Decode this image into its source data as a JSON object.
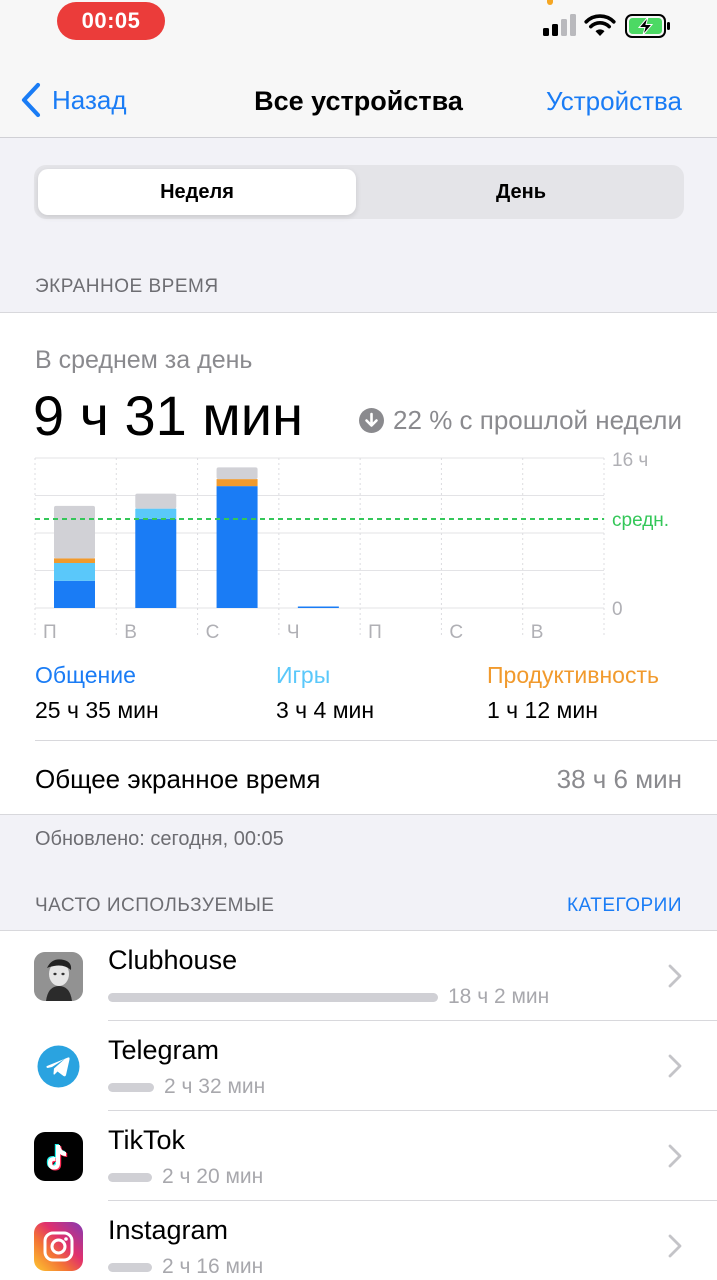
{
  "status": {
    "time": "00:05"
  },
  "nav": {
    "back_label": "Назад",
    "title": "Все устройства",
    "right_label": "Устройства"
  },
  "segments": {
    "week": "Неделя",
    "day": "День",
    "selected": "week"
  },
  "screen_time_header": "ЭКРАННОЕ ВРЕМЯ",
  "summary": {
    "avg_label": "В среднем за день",
    "avg_value": "9 ч 31 мин",
    "change": "22 % с прошлой недели",
    "change_direction": "down"
  },
  "chart_data": {
    "type": "bar",
    "categories": [
      "П",
      "В",
      "С",
      "Ч",
      "П",
      "С",
      "В"
    ],
    "unit": "hours",
    "ylim": [
      0,
      16
    ],
    "tick_labels": {
      "top": "16 ч",
      "bottom": "0"
    },
    "average_label": "средн.",
    "average_value": 9.5,
    "series": [
      {
        "name": "Общение",
        "color": "#1a7cf5",
        "values": [
          2.9,
          9.5,
          13.0,
          0.15,
          0,
          0,
          0
        ]
      },
      {
        "name": "Игры",
        "color": "#5ac8fa",
        "values": [
          1.9,
          1.1,
          0,
          0,
          0,
          0,
          0
        ]
      },
      {
        "name": "Продуктивность",
        "color": "#f19a2d",
        "values": [
          0.5,
          0,
          0.75,
          0,
          0,
          0,
          0
        ]
      },
      {
        "values": [
          5.6,
          1.6,
          1.25,
          0,
          0,
          0,
          0
        ],
        "color": "#d1d1d6"
      }
    ]
  },
  "categories": [
    {
      "name": "Общение",
      "time": "25 ч 35 мин",
      "color": "#1a7cf5"
    },
    {
      "name": "Игры",
      "time": "3 ч 4 мин",
      "color": "#5ac8fa"
    },
    {
      "name": "Продуктивность",
      "time": "1 ч 12 мин",
      "color": "#f19a2d"
    }
  ],
  "total": {
    "label": "Общее экранное время",
    "value": "38 ч 6 мин"
  },
  "updated": "Обновлено: сегодня, 00:05",
  "frequent": {
    "header": "ЧАСТО ИСПОЛЬЗУЕМЫЕ",
    "link": "КАТЕГОРИИ"
  },
  "apps": [
    {
      "name": "Clubhouse",
      "time": "18 ч 2 мин",
      "share": 1.0,
      "icon": "clubhouse-icon"
    },
    {
      "name": "Telegram",
      "time": "2 ч 32 мин",
      "share": 0.14,
      "icon": "telegram-icon"
    },
    {
      "name": "TikTok",
      "time": "2 ч 20 мин",
      "share": 0.13,
      "icon": "tiktok-icon"
    },
    {
      "name": "Instagram",
      "time": "2 ч 16 мин",
      "share": 0.13,
      "icon": "instagram-icon"
    }
  ]
}
